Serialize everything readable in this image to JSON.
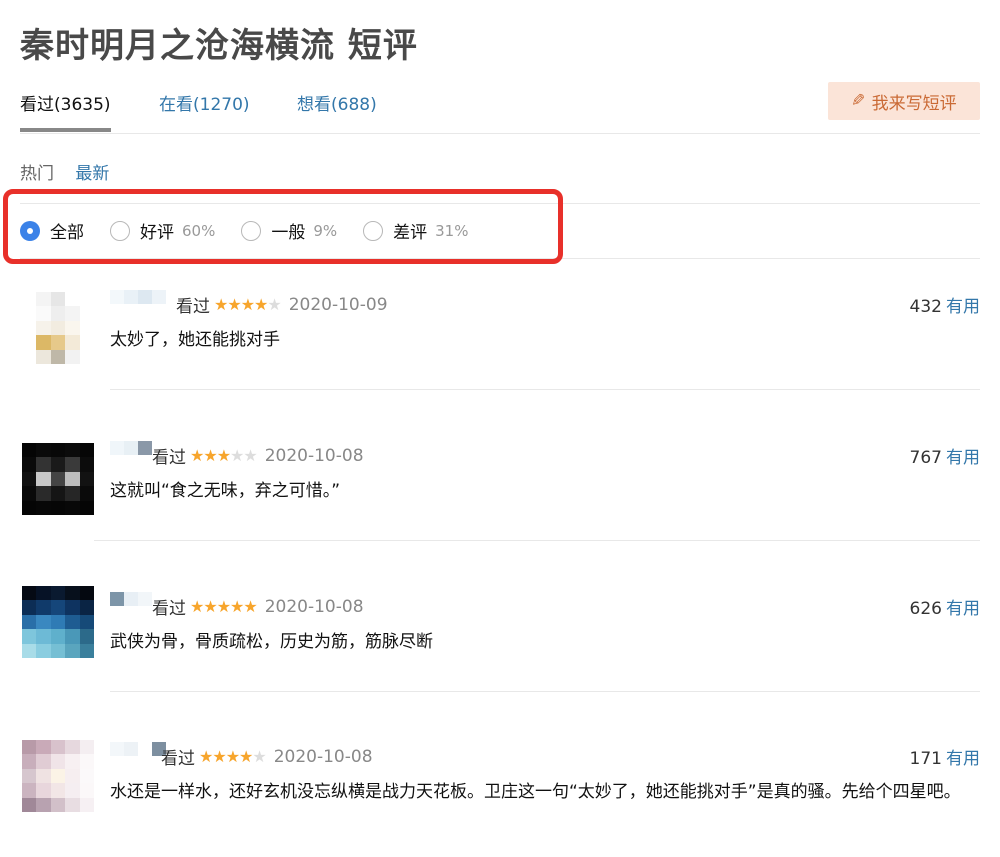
{
  "page": {
    "title": "秦时明月之沧海横流 短评"
  },
  "tabs": [
    {
      "label": "看过(3635)"
    },
    {
      "label": "在看(1270)"
    },
    {
      "label": "想看(688)"
    }
  ],
  "write_button": {
    "label": "我来写短评",
    "icon": "pencil-icon"
  },
  "sort": {
    "hot": "热门",
    "latest": "最新"
  },
  "filter": {
    "options": [
      {
        "label": "全部",
        "pct": "",
        "checked": true
      },
      {
        "label": "好评",
        "pct": "60%",
        "checked": false
      },
      {
        "label": "一般",
        "pct": "9%",
        "checked": false
      },
      {
        "label": "差评",
        "pct": "31%",
        "checked": false
      }
    ]
  },
  "colors": {
    "link": "#3377aa",
    "star": "#f7a52c",
    "highlight_box": "#e8302a",
    "write_button_bg": "#fbe4d8"
  },
  "comments": [
    {
      "status": "看过",
      "stars": 4,
      "rating_max": 5,
      "date": "2020-10-09",
      "votes": "432",
      "useful": "有用",
      "text": "太妙了，她还能挑对手"
    },
    {
      "status": "看过",
      "stars": 3,
      "rating_max": 5,
      "date": "2020-10-08",
      "votes": "767",
      "useful": "有用",
      "text": "这就叫“食之无味，弃之可惜。”"
    },
    {
      "status": "看过",
      "stars": 5,
      "rating_max": 5,
      "date": "2020-10-08",
      "votes": "626",
      "useful": "有用",
      "text": "武侠为骨，骨质疏松，历史为筋，筋脉尽断"
    },
    {
      "status": "看过",
      "stars": 4,
      "rating_max": 5,
      "date": "2020-10-08",
      "votes": "171",
      "useful": "有用",
      "text": "水还是一样水，还好玄机没忘纵横是战力天花板。卫庄这一句“太妙了，她还能挑对手”是真的骚。先给个四星吧。"
    }
  ]
}
